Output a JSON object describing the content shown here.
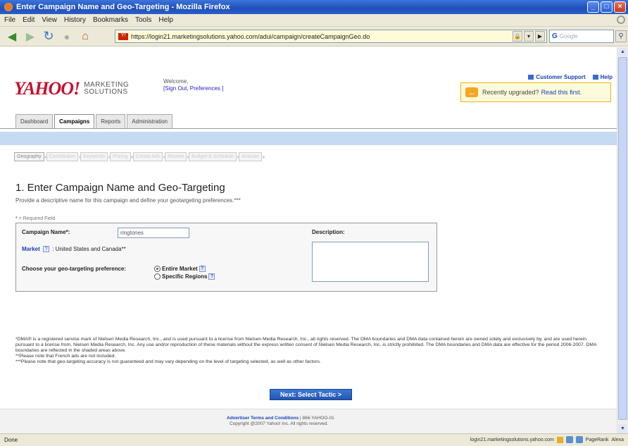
{
  "window": {
    "title": "Enter Campaign Name and Geo-Targeting - Mozilla Firefox",
    "buttons": [
      "_",
      "□",
      "×"
    ]
  },
  "menu": [
    "File",
    "Edit",
    "View",
    "History",
    "Bookmarks",
    "Tools",
    "Help"
  ],
  "toolbar": {
    "url": "https://login21.marketingsolutions.yahoo.com/adui/campaign/createCampaignGeo.do",
    "search_placeholder": "Google",
    "search_engine": "G"
  },
  "header": {
    "logo": "YAHOO!",
    "logo_sub_1": "MARKETING",
    "logo_sub_2": "SOLUTIONS",
    "welcome": "Welcome,",
    "signout": "[Sign Out, Preferences ]",
    "customer_support": "Customer Support",
    "help": "Help",
    "upgraded_text": "Recently upgraded?",
    "upgraded_link": "Read this first."
  },
  "tabs": [
    "Dashboard",
    "Campaigns",
    "Reports",
    "Administration"
  ],
  "active_tab": "Campaigns",
  "steps": [
    "Geography",
    "Contribution",
    "Keywords",
    "Pricing",
    "Create Ads",
    "Review",
    "Budget & Schedule",
    "Activate"
  ],
  "page": {
    "title": "1. Enter Campaign Name and Geo-Targeting",
    "intro": "Provide a descriptive name for this campaign and define your geotargeting preferences.***",
    "required_star": "*",
    "required_text": "= Required Field"
  },
  "form": {
    "name_label": "Campaign Name*:",
    "name_value": "ringtones",
    "market_label": "Market",
    "market_value": ": United States and Canada**",
    "geo_label": "Choose your geo-targeting preference:",
    "option_entire": "Entire Market",
    "option_specific": "Specific Regions",
    "selected_option": "Entire Market",
    "description_label": "Description:",
    "help_icon": "?"
  },
  "footnotes": {
    "dma": "*DMA® is a registered service mark of Nielsen Media Research, Inc., and is used pursuant to a license from Nielsen Media Research, Inc., all rights reserved. The DMA boundaries and DMA data contained herein are owned solely and exclusively by, and are used herein pursuant to a license from, Nielsen Media Research, Inc. Any use and/or reproduction of these materials without the express written consent of Nielsen Media Research, Inc. is strictly prohibited. The DMA boundaries and DMA data are effective for the period 2006-2007. DMA boundaries are reflected in the shaded areas above.",
    "french": "**Please note that French ads are not included.",
    "accuracy": "***Please note that geo-targeting accuracy is not guaranteed and may vary depending on the level of targeting selected, as well as other factors."
  },
  "next_button": "Next: Select Tactic >",
  "footer": {
    "terms": "Advertiser Terms and Conditions",
    "phone": "| 866-YAHOO-01",
    "copyright": "Copyright @2007 Yahoo! Inc. All rights reserved."
  },
  "status": {
    "left": "Done",
    "host": "login21.marketingsolutions.yahoo.com",
    "pagerank": "PageRank",
    "alexa": "Alexa"
  }
}
